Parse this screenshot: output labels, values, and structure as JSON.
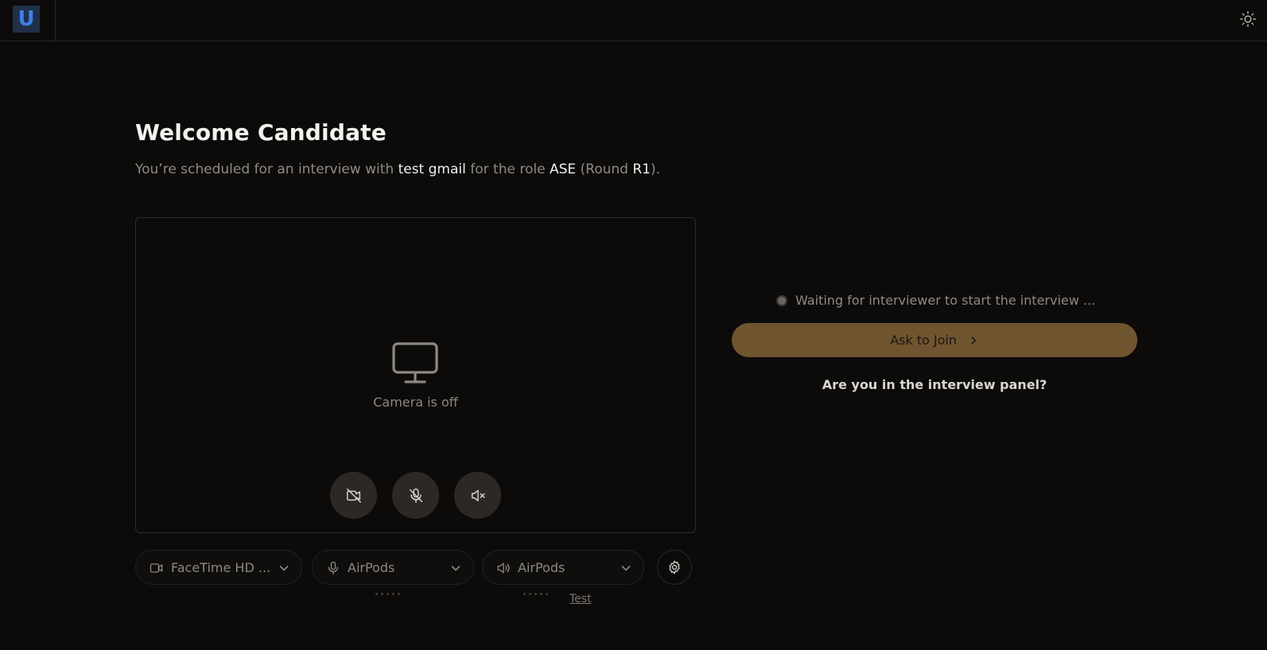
{
  "header": {
    "logo_text": "U"
  },
  "welcome": {
    "title": "Welcome Candidate",
    "subtitle_prefix": "You’re scheduled for an interview with ",
    "interviewer": "test gmail",
    "subtitle_mid": " for the role ",
    "role": "ASE",
    "round_prefix": " (Round ",
    "round": "R1",
    "round_suffix": ")."
  },
  "preview": {
    "camera_status": "Camera is off"
  },
  "devices": {
    "camera": "FaceTime HD ...",
    "microphone": "AirPods",
    "speaker": "AirPods",
    "test_label": "Test"
  },
  "status": {
    "waiting_text": "Waiting for interviewer to start the interview ..."
  },
  "actions": {
    "ask_to_join": "Ask to Join",
    "panel_question": "Are you in the interview panel?"
  },
  "colors": {
    "background": "#0d0b0a",
    "accent": "#6f5430",
    "logo_blue": "#3e7fe8"
  },
  "icons": {
    "theme": "sun-icon",
    "preview": "monitor-icon",
    "camera_toggle": "video-off-icon",
    "mic_toggle": "mic-off-icon",
    "speaker_toggle": "volume-mute-icon",
    "settings": "gear-icon"
  }
}
